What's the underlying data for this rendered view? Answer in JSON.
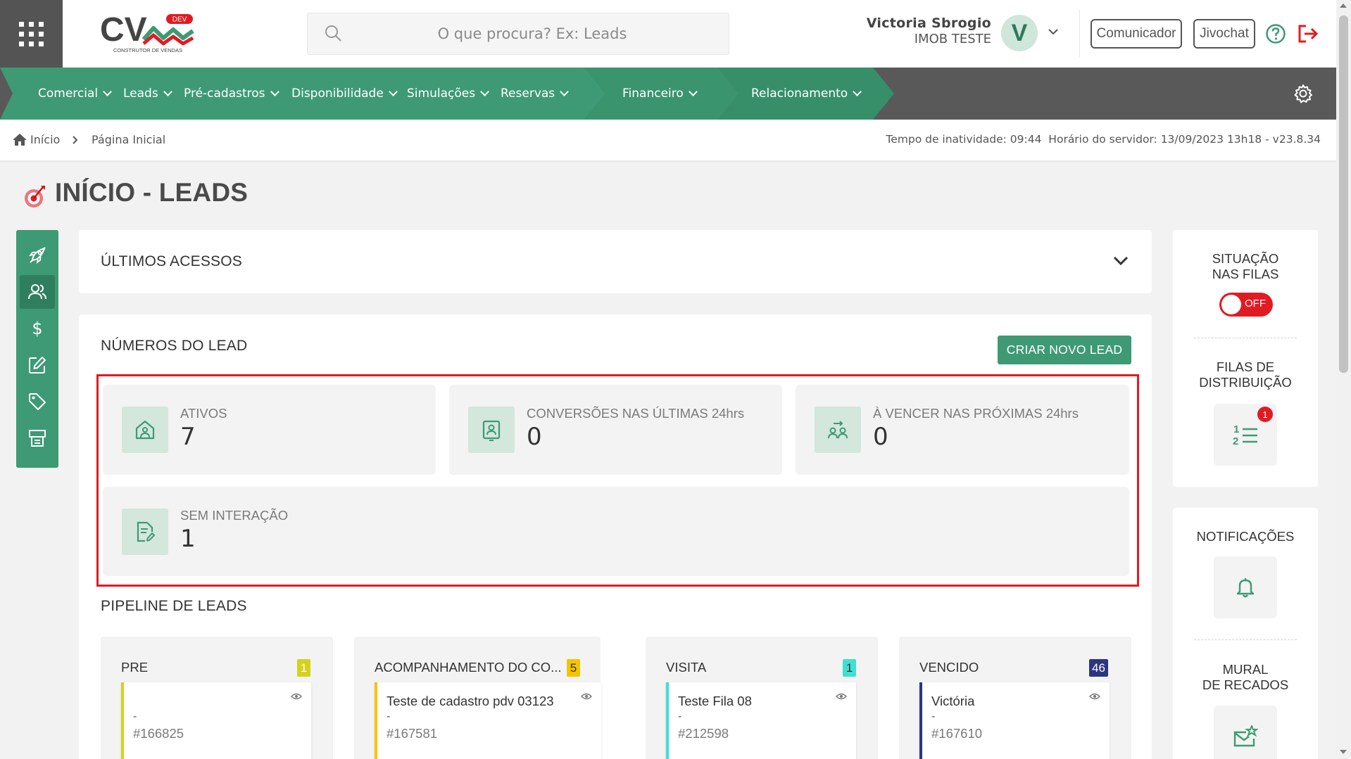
{
  "header": {
    "logo_text": "CV",
    "logo_tagline": "CONSTRUTOR DE VENDAS",
    "logo_badge": "DEV",
    "search_placeholder": "O que procura? Ex: Leads",
    "user_name": "Victoria Sbrogio",
    "user_company": "IMOB TESTE",
    "avatar_initial": "V",
    "comunicador_label": "Comunicador",
    "jivochat_label": "Jivochat"
  },
  "nav": {
    "items": [
      {
        "label": "Comercial"
      },
      {
        "label": "Leads"
      },
      {
        "label": "Pré-cadastros"
      },
      {
        "label": "Disponibilidade"
      },
      {
        "label": "Simulações"
      },
      {
        "label": "Reservas"
      },
      {
        "label": "Financeiro"
      },
      {
        "label": "Relacionamento"
      }
    ]
  },
  "breadcrumb": {
    "home": "Início",
    "current": "Página Inicial",
    "server_info": "Tempo de inatividade: 09:44  Horário do servidor: 13/09/2023 13h18 - v23.8.34"
  },
  "page": {
    "title": "INÍCIO - LEADS"
  },
  "ultimos_acessos": {
    "title": "ÚLTIMOS ACESSOS"
  },
  "numeros": {
    "title": "NÚMEROS DO LEAD",
    "create_button": "CRIAR NOVO LEAD",
    "stats": [
      {
        "label": "ATIVOS",
        "value": "7"
      },
      {
        "label": "CONVERSÕES NAS ÚLTIMAS 24hrs",
        "value": "0"
      },
      {
        "label": "À VENCER NAS PRÓXIMAS 24hrs",
        "value": "0"
      },
      {
        "label": "SEM INTERAÇÃO",
        "value": "1"
      }
    ]
  },
  "pipeline": {
    "title": "PIPELINE DE LEADS",
    "columns": [
      {
        "name": "PRE",
        "count": "1",
        "card_title": "",
        "card_dash": "-",
        "card_id": "#166825"
      },
      {
        "name": "ACOMPANHAMENTO DO CO...",
        "count": "5",
        "card_title": "Teste de cadastro pdv 03123",
        "card_dash": "-",
        "card_id": "#167581"
      },
      {
        "name": "VISITA",
        "count": "1",
        "card_title": "Teste Fila 08",
        "card_dash": "-",
        "card_id": "#212598"
      },
      {
        "name": "VENCIDO",
        "count": "46",
        "card_title": "Victória",
        "card_dash": "-",
        "card_id": "#167610"
      }
    ]
  },
  "right_panel": {
    "situacao_line1": "SITUAÇÃO",
    "situacao_line2": "NAS FILAS",
    "toggle_label": "OFF",
    "filas_line1": "FILAS DE",
    "filas_line2": "DISTRIBUIÇÃO",
    "filas_badge": "1",
    "notificacoes": "NOTIFICAÇÕES",
    "mural_line1": "MURAL",
    "mural_line2": "DE RECADOS"
  },
  "colors": {
    "brand_green": "#3e9a74",
    "dark_green": "#2f7f5e",
    "nav_gray": "#595959",
    "alert_red": "#e11b23"
  }
}
